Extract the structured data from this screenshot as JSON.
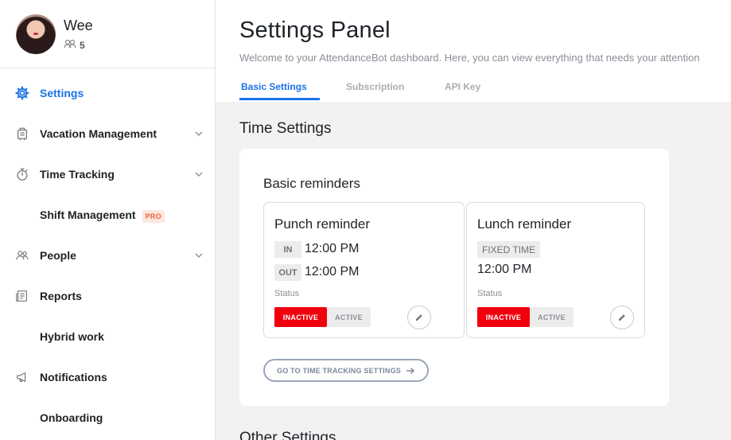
{
  "user": {
    "name": "Wee",
    "members_count": "5"
  },
  "sidebar": {
    "items": [
      {
        "label": "Settings",
        "icon": "gear-icon",
        "active": true
      },
      {
        "label": "Vacation Management",
        "icon": "luggage-icon",
        "expandable": true
      },
      {
        "label": "Time Tracking",
        "icon": "stopwatch-icon",
        "expandable": true
      },
      {
        "label": "Shift Management",
        "badge": "PRO"
      },
      {
        "label": "People",
        "icon": "people-icon",
        "expandable": true
      },
      {
        "label": "Reports",
        "icon": "report-icon"
      },
      {
        "label": "Hybrid work"
      },
      {
        "label": "Notifications",
        "icon": "megaphone-icon"
      },
      {
        "label": "Onboarding"
      }
    ]
  },
  "header": {
    "title": "Settings Panel",
    "subtitle": "Welcome to your AttendanceBot dashboard. Here, you can view everything that needs your attention",
    "tabs": [
      {
        "label": "Basic Settings",
        "active": true
      },
      {
        "label": "Subscription"
      },
      {
        "label": "API Key"
      }
    ]
  },
  "time_settings": {
    "section_title": "Time Settings",
    "card_title": "Basic reminders",
    "punch": {
      "title": "Punch reminder",
      "in_tag": "IN",
      "in_time": "12:00 PM",
      "out_tag": "OUT",
      "out_time": "12:00 PM",
      "status_label": "Status",
      "inactive": "INACTIVE",
      "active": "ACTIVE",
      "state": "inactive"
    },
    "lunch": {
      "title": "Lunch reminder",
      "tag": "FIXED TIME",
      "time": "12:00 PM",
      "status_label": "Status",
      "inactive": "INACTIVE",
      "active": "ACTIVE",
      "state": "inactive"
    },
    "go_button": "GO TO TIME TRACKING SETTINGS"
  },
  "other_section_title": "Other Settings",
  "colors": {
    "accent": "#1a73e8",
    "inactive_red": "#f0000c",
    "pro_orange": "#e8643b"
  }
}
